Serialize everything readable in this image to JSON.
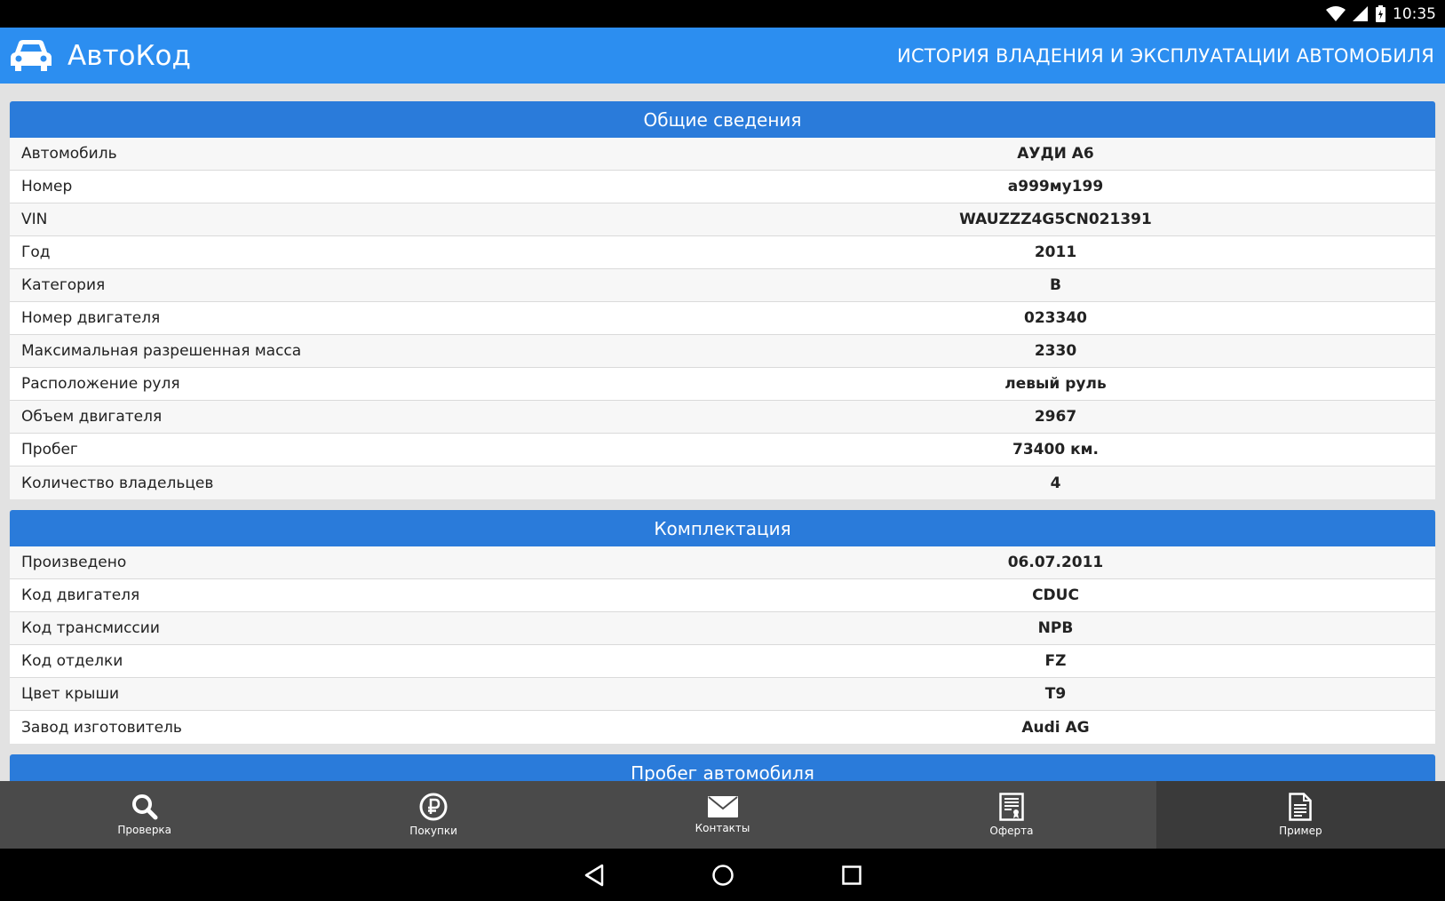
{
  "status_bar": {
    "time": "10:35"
  },
  "app_bar": {
    "title": "АвтоКод",
    "subtitle": "ИСТОРИЯ ВЛАДЕНИЯ И ЭКСПЛУАТАЦИИ АВТОМОБИЛЯ",
    "logo_icon": "car-icon"
  },
  "sections": [
    {
      "title": "Общие сведения",
      "rows": [
        {
          "label": "Автомобиль",
          "value": "АУДИ А6"
        },
        {
          "label": "Номер",
          "value": "а999му199"
        },
        {
          "label": "VIN",
          "value": "WAUZZZ4G5CN021391"
        },
        {
          "label": "Год",
          "value": "2011"
        },
        {
          "label": "Категория",
          "value": "B"
        },
        {
          "label": "Номер двигателя",
          "value": "023340"
        },
        {
          "label": "Максимальная разрешенная масса",
          "value": "2330"
        },
        {
          "label": "Расположение руля",
          "value": "левый руль"
        },
        {
          "label": "Объем двигателя",
          "value": "2967"
        },
        {
          "label": "Пробег",
          "value": "73400 км."
        },
        {
          "label": "Количество владельцев",
          "value": "4"
        }
      ]
    },
    {
      "title": "Комплектация",
      "rows": [
        {
          "label": "Произведено",
          "value": "06.07.2011"
        },
        {
          "label": "Код двигателя",
          "value": "CDUC"
        },
        {
          "label": "Код трансмиссии",
          "value": "NPB"
        },
        {
          "label": "Код отделки",
          "value": "FZ"
        },
        {
          "label": "Цвет крыши",
          "value": "T9"
        },
        {
          "label": "Завод изготовитель",
          "value": "Audi AG"
        }
      ]
    },
    {
      "title": "Пробег автомобиля",
      "rows": []
    }
  ],
  "bottom_nav": [
    {
      "label": "Проверка",
      "icon": "search-icon",
      "active": false
    },
    {
      "label": "Покупки",
      "icon": "ruble-icon",
      "active": false
    },
    {
      "label": "Контакты",
      "icon": "mail-icon",
      "active": false
    },
    {
      "label": "Оферта",
      "icon": "certificate-icon",
      "active": false
    },
    {
      "label": "Пример",
      "icon": "document-icon",
      "active": true
    }
  ]
}
